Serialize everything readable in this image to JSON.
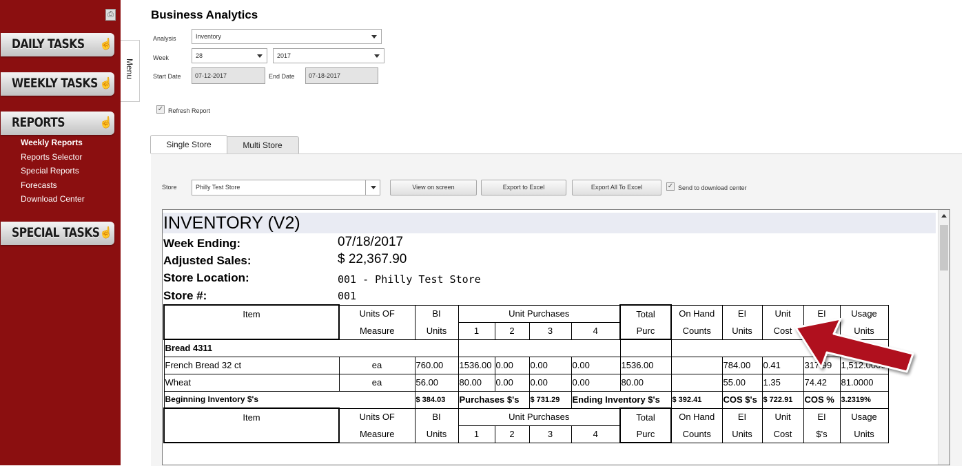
{
  "sidebar": {
    "buttons": [
      "DAILY TASKS",
      "WEEKLY TASKS",
      "REPORTS",
      "SPECIAL TASKS"
    ],
    "report_items": [
      "Weekly Reports",
      "Reports Selector",
      "Special Reports",
      "Forecasts",
      "Download Center"
    ]
  },
  "menu_tab": "Menu",
  "header": {
    "title": "Business Analytics",
    "analysis_label": "Analysis",
    "analysis_value": "Inventory",
    "week_label": "Week",
    "week_value": "28",
    "year_value": "2017",
    "start_label": "Start Date",
    "start_value": "07-12-2017",
    "end_label": "End Date",
    "end_value": "07-18-2017",
    "refresh_label": "Refresh Report"
  },
  "tabs": [
    "Single Store",
    "Multi Store"
  ],
  "toolbar": {
    "store_label": "Store",
    "store_value": "Philly Test Store",
    "view_btn": "View on screen",
    "export_btn": "Export to Excel",
    "export_all_btn": "Export All To Excel",
    "download_label": "Send to download center"
  },
  "report": {
    "title": "INVENTORY (V2)",
    "week_ending_label": "Week Ending:",
    "week_ending_value": "07/18/2017",
    "adj_sales_label": "Adjusted Sales:",
    "adj_sales_value": "$ 22,367.90",
    "location_label": "Store Location:",
    "location_value": "001 - Philly Test Store",
    "store_num_label": "Store #:",
    "store_num_value": "001",
    "col": {
      "item": "Item",
      "uom1": "Units OF",
      "uom2": "Measure",
      "bi1": "BI",
      "bi2": "Units",
      "unit_purch": "Unit Purchases",
      "p1": "1",
      "p2": "2",
      "p3": "3",
      "p4": "4",
      "total1": "Total",
      "total2": "Purc",
      "onhand1": "On Hand",
      "onhand2": "Counts",
      "ei1": "EI",
      "ei2": "Units",
      "uc1": "Unit",
      "uc2": "Cost",
      "eid1": "EI",
      "eid2": "$'s",
      "usage1": "Usage",
      "usage2": "Units"
    },
    "category": "Bread 4311",
    "rows": [
      {
        "item": "French Bread 32 ct",
        "uom": "ea",
        "bi": "760.00",
        "p1": "1536.00",
        "p2": "0.00",
        "p3": "0.00",
        "p4": "0.00",
        "total": "1536.00",
        "onhand": "",
        "ei": "784.00",
        "uc": "0.41",
        "eid": "317.99",
        "usage": "1,512.0000"
      },
      {
        "item": "Wheat",
        "uom": "ea",
        "bi": "56.00",
        "p1": "80.00",
        "p2": "0.00",
        "p3": "0.00",
        "p4": "0.00",
        "total": "80.00",
        "onhand": "",
        "ei": "55.00",
        "uc": "1.35",
        "eid": "74.42",
        "usage": "81.0000"
      }
    ],
    "summary": {
      "bi_label": "Beginning Inventory $'s",
      "bi_value": "$ 384.03",
      "purch_label": "Purchases $'s",
      "purch_value": "$ 731.29",
      "ei_label": "Ending Inventory $'s",
      "ei_value": "$ 392.41",
      "cos_label": "COS $'s",
      "cos_value": "$ 722.91",
      "cosp_label": "COS %",
      "cosp_value": "3.2319%"
    }
  },
  "colors": {
    "sidebar": "#8b0f10",
    "arrow": "#b0101e"
  }
}
